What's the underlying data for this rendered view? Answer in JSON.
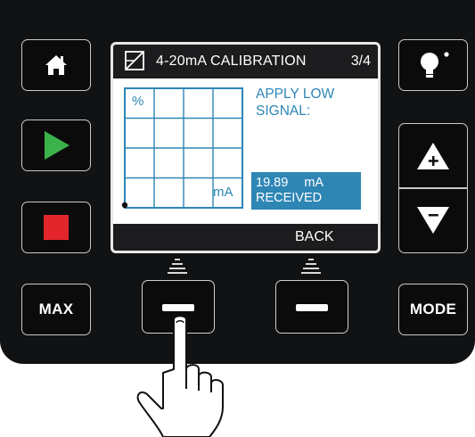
{
  "screen": {
    "title": "4-20mA CALIBRATION",
    "page": "3/4",
    "instruction_line1": "APPLY LOW",
    "instruction_line2": "SIGNAL:",
    "received_value": "19.89",
    "received_unit": "mA",
    "received_label": "RECEIVED",
    "graph_y_label": "%",
    "graph_x_label": "mA",
    "footer_label": "BACK"
  },
  "buttons": {
    "max_label": "MAX",
    "mode_label": "MODE"
  },
  "icons": {
    "home": "home-icon",
    "play": "play-icon",
    "stop": "stop-icon",
    "light": "lightbulb-icon",
    "up": "up-arrow-plus-icon",
    "down": "down-arrow-minus-icon",
    "calibration": "calibration-slope-icon",
    "hand": "pointing-hand-icon"
  },
  "colors": {
    "accent": "#2e86b5",
    "play": "#3bb34a",
    "stop": "#e3262b",
    "panel": "#111214"
  }
}
